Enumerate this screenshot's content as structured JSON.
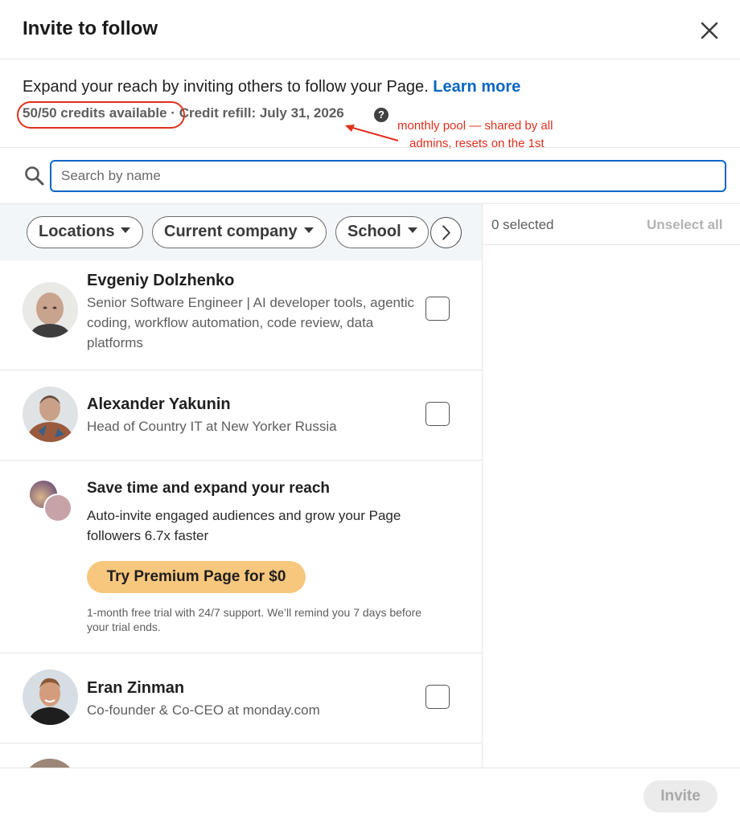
{
  "dialog": {
    "title": "Invite to follow",
    "close_icon": "close-icon"
  },
  "intro": {
    "text": "Expand your reach by inviting others to follow your Page.",
    "learn_more": "Learn more"
  },
  "credits": {
    "available": "50/50 credits available",
    "separator": "·",
    "refill": "Credit refill: July 31, 2026",
    "help_icon": "question-circle-icon",
    "help_glyph": "?"
  },
  "annotation": {
    "line1": "monthly pool — shared by all",
    "line2": "admins, resets on the 1st",
    "color": "#e0301e"
  },
  "search": {
    "placeholder": "Search by name",
    "value": "",
    "icon": "search-icon"
  },
  "filters": {
    "items": [
      {
        "label": "Locations"
      },
      {
        "label": "Current company"
      },
      {
        "label": "School"
      }
    ],
    "next_icon": "chevron-right-icon"
  },
  "selection": {
    "count_label": "0 selected",
    "unselect_all": "Unselect all"
  },
  "people": [
    {
      "name": "Evgeniy Dolzhenko",
      "headline": "Senior Software Engineer | AI developer tools, agentic coding, workflow automation, code review, data platforms",
      "checked": false
    },
    {
      "name": "Alexander Yakunin",
      "headline": "Head of Country IT at New Yorker Russia",
      "checked": false
    },
    {
      "name": "Eran Zinman",
      "headline": "Co-founder & Co-CEO at monday.com",
      "checked": false
    }
  ],
  "promo": {
    "title": "Save time and expand your reach",
    "body": "Auto-invite engaged audiences and grow your Page followers 6.7x faster",
    "button": "Try Premium Page for $0",
    "note": "1-month free trial with 24/7 support. We’ll remind you 7 days before your trial ends."
  },
  "footer": {
    "invite": "Invite"
  },
  "colors": {
    "link": "#0a66c2",
    "premium": "#f8c77e",
    "annotation": "#e0301e"
  }
}
